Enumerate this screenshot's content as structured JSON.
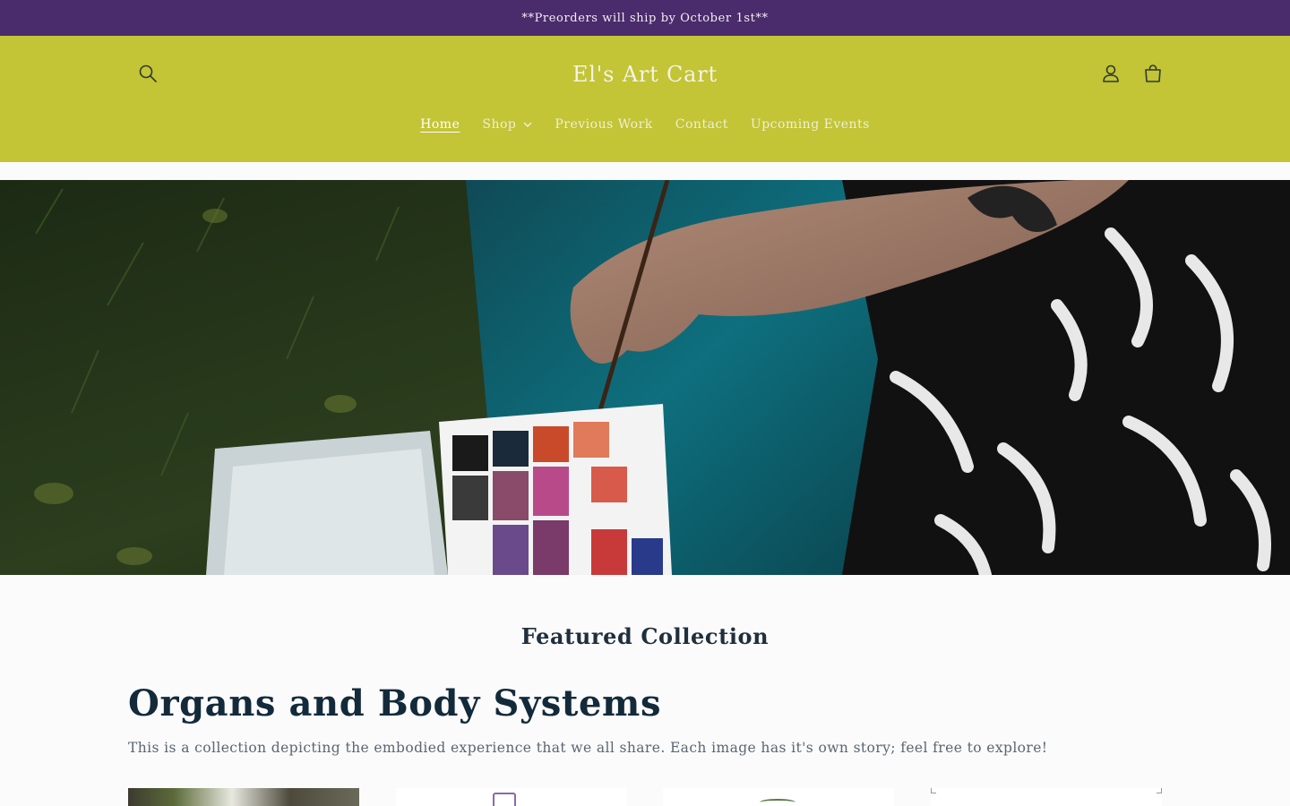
{
  "announcement": {
    "text": "**Preorders will ship by October 1st**"
  },
  "header": {
    "logo": "El's Art Cart",
    "nav": [
      {
        "label": "Home",
        "active": true
      },
      {
        "label": "Shop",
        "has_dropdown": true
      },
      {
        "label": "Previous Work"
      },
      {
        "label": "Contact"
      },
      {
        "label": "Upcoming Events"
      }
    ],
    "icons": [
      "search-icon",
      "account-icon",
      "cart-icon"
    ]
  },
  "colors": {
    "announcement_bg": "#4a2b6b",
    "header_bg": "#c3c436",
    "page_bg": "#fbfbfb",
    "heading_text": "#132a3a"
  },
  "featured": {
    "heading": "Featured Collection",
    "collection_title": "Organs and Body Systems",
    "collection_description": "This is a collection depicting the embodied experience that we all share. Each image has it's own story; feel free to explore!"
  }
}
